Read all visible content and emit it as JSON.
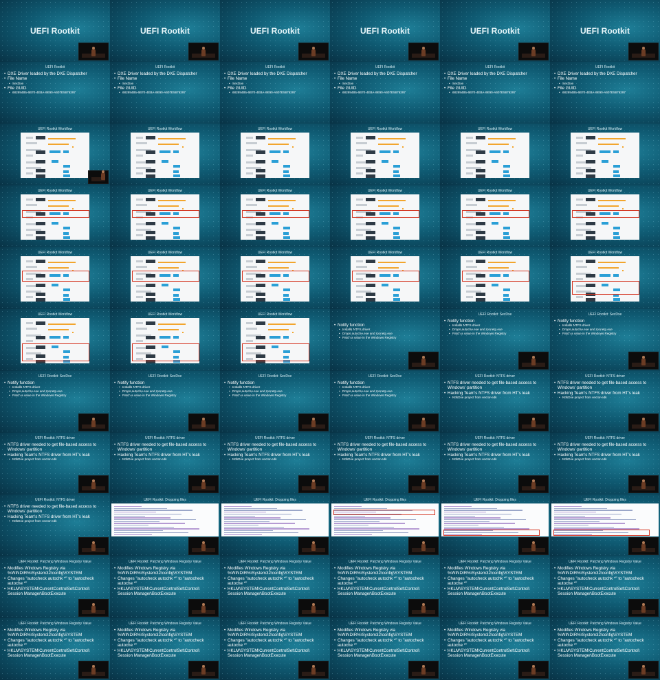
{
  "columns": 6,
  "rows": 11,
  "text": {
    "rootkit_title": "UEFI Rootkit",
    "dxe_header": "UEFI Rootkit",
    "dxe_bullets": [
      {
        "lvl": 1,
        "text": "DXE Driver loaded by the DXE Dispatcher"
      },
      {
        "lvl": 1,
        "text": "File Name"
      },
      {
        "lvl": 2,
        "text": "SecDxe"
      },
      {
        "lvl": 1,
        "text": "File GUID"
      },
      {
        "lvl": 2,
        "text": "682894B5-6B70-4EBA-9E90-A607E5676297"
      }
    ],
    "workflow_header": "UEFI Rootkit Workflow",
    "secdxe_header": "UEFI Rootkit: SecDxe",
    "secdxe_bullets": [
      {
        "lvl": 1,
        "text": "Notify function"
      },
      {
        "lvl": 2,
        "text": "Installs NTFS driver"
      },
      {
        "lvl": 2,
        "text": "Drops autoche.exe and rpcnetp.exe"
      },
      {
        "lvl": 2,
        "text": "Patch a value in the Windows Registry"
      }
    ],
    "ntfs_header": "UEFI Rootkit: NTFS driver",
    "ntfs_bullets": [
      {
        "lvl": 1,
        "text": "NTFS driver needed to get file-based access to Windows' partition"
      },
      {
        "lvl": 1,
        "text": "Hacking Team's NTFS driver from HT's leak"
      },
      {
        "lvl": 2,
        "text": "NtfsDxe project from vector-edk"
      }
    ],
    "drop_header": "UEFI Rootkit: Dropping files",
    "reg_header": "UEFI Rootkit: Patching Windows Registry Value",
    "reg_bullets": [
      {
        "lvl": 1,
        "text": "Modifies Windows Registry via %WINDIR%\\System32\\config\\SYSTEM"
      },
      {
        "lvl": 1,
        "text": "Changes \"autocheck autochk *\" to \"autocheck autoche *\""
      },
      {
        "lvl": 1,
        "text": "HKLM\\SYSTEM\\CurrentControlSet\\Control\\ Session Manager\\BootExecute"
      }
    ]
  },
  "slides": [
    {
      "t": "title"
    },
    {
      "t": "title"
    },
    {
      "t": "title"
    },
    {
      "t": "title"
    },
    {
      "t": "title"
    },
    {
      "t": "title"
    },
    {
      "t": "dxe"
    },
    {
      "t": "dxe"
    },
    {
      "t": "dxe"
    },
    {
      "t": "dxe"
    },
    {
      "t": "dxe"
    },
    {
      "t": "dxe"
    },
    {
      "t": "wf",
      "hl": "none",
      "video": true
    },
    {
      "t": "wf",
      "hl": "none"
    },
    {
      "t": "wf",
      "hl": "none"
    },
    {
      "t": "wf",
      "hl": "none"
    },
    {
      "t": "wf",
      "hl": "none"
    },
    {
      "t": "wf",
      "hl": "none"
    },
    {
      "t": "wf",
      "hl": "top"
    },
    {
      "t": "wf",
      "hl": "top"
    },
    {
      "t": "wf",
      "hl": "top"
    },
    {
      "t": "wf",
      "hl": "top"
    },
    {
      "t": "wf",
      "hl": "top"
    },
    {
      "t": "wf",
      "hl": "top"
    },
    {
      "t": "wf",
      "hl": "mid"
    },
    {
      "t": "wf",
      "hl": "mid"
    },
    {
      "t": "wf",
      "hl": "mid"
    },
    {
      "t": "wf",
      "hl": "mid"
    },
    {
      "t": "wf",
      "hl": "mid"
    },
    {
      "t": "wf",
      "hl": "low"
    },
    {
      "t": "wf",
      "hl": "bottom"
    },
    {
      "t": "wf",
      "hl": "bottom"
    },
    {
      "t": "wf",
      "hl": "bottom"
    },
    {
      "t": "secdxe",
      "video": true,
      "nohdr": true
    },
    {
      "t": "secdxe",
      "video": true
    },
    {
      "t": "secdxe",
      "video": true
    },
    {
      "t": "secdxe",
      "video": true
    },
    {
      "t": "secdxe",
      "video": true
    },
    {
      "t": "secdxe",
      "video": true
    },
    {
      "t": "secdxe",
      "video": true
    },
    {
      "t": "ntfs",
      "video": true
    },
    {
      "t": "ntfs",
      "video": true
    },
    {
      "t": "ntfs",
      "video": true
    },
    {
      "t": "ntfs",
      "video": true
    },
    {
      "t": "ntfs",
      "video": true
    },
    {
      "t": "ntfs",
      "video": true
    },
    {
      "t": "ntfs",
      "video": true
    },
    {
      "t": "ntfs",
      "video": true
    },
    {
      "t": "ntfs",
      "video": true
    },
    {
      "t": "code",
      "hl": "none",
      "video": true
    },
    {
      "t": "code",
      "hl": "none",
      "video": true
    },
    {
      "t": "code",
      "hl": "mid",
      "video": true
    },
    {
      "t": "code",
      "hl": "bottom",
      "video": true
    },
    {
      "t": "code",
      "hl": "bottom",
      "video": true
    },
    {
      "t": "reg",
      "video": true
    },
    {
      "t": "reg",
      "video": true
    },
    {
      "t": "reg",
      "video": true
    },
    {
      "t": "reg",
      "video": true
    },
    {
      "t": "reg",
      "video": true
    },
    {
      "t": "reg",
      "video": true
    },
    {
      "t": "reg",
      "video": true
    },
    {
      "t": "reg",
      "video": true
    },
    {
      "t": "reg",
      "video": true
    },
    {
      "t": "reg",
      "video": true
    },
    {
      "t": "reg",
      "video": true
    },
    {
      "t": "reg",
      "video": true
    }
  ]
}
